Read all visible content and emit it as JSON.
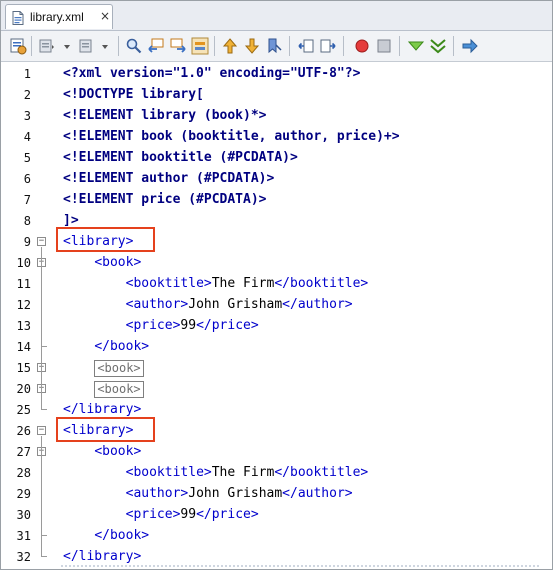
{
  "tab": {
    "title": "library.xml",
    "close": "×"
  },
  "toolbar": {
    "icons": [
      "source-history-icon",
      "back-icon",
      "forward-icon",
      "find-icon",
      "find-previous-icon",
      "find-next-icon",
      "toggle-highlight-icon",
      "previous-bookmark-icon",
      "next-bookmark-icon",
      "toggle-bookmark-icon",
      "shift-left-icon",
      "shift-right-icon",
      "start-macro-icon",
      "stop-macro-icon",
      "check-xml-icon",
      "validate-xml-icon",
      "xsl-transform-icon"
    ]
  },
  "editor": {
    "lines": [
      {
        "num": "1",
        "fold": "",
        "parts": [
          {
            "c": "dtd",
            "t": "<?xml version=\"1.0\" encoding=\"UTF-8\"?>"
          }
        ]
      },
      {
        "num": "2",
        "fold": "",
        "parts": [
          {
            "c": "dtd",
            "t": "<!DOCTYPE library["
          }
        ]
      },
      {
        "num": "3",
        "fold": "",
        "parts": [
          {
            "c": "dtd",
            "t": "<!ELEMENT library (book)*>"
          }
        ]
      },
      {
        "num": "4",
        "fold": "",
        "parts": [
          {
            "c": "dtd",
            "t": "<!ELEMENT book (booktitle, author, price)+>"
          }
        ]
      },
      {
        "num": "5",
        "fold": "",
        "parts": [
          {
            "c": "dtd",
            "t": "<!ELEMENT booktitle (#PCDATA)>"
          }
        ]
      },
      {
        "num": "6",
        "fold": "",
        "parts": [
          {
            "c": "dtd",
            "t": "<!ELEMENT author (#PCDATA)>"
          }
        ]
      },
      {
        "num": "7",
        "fold": "",
        "parts": [
          {
            "c": "dtd",
            "t": "<!ELEMENT price (#PCDATA)>"
          }
        ]
      },
      {
        "num": "8",
        "fold": "",
        "parts": [
          {
            "c": "dtd",
            "t": "]>"
          }
        ]
      },
      {
        "num": "9",
        "fold": "−",
        "parts": [
          {
            "c": "tagc",
            "t": "<library>"
          }
        ]
      },
      {
        "num": "10",
        "fold": "−",
        "parts": [
          {
            "c": "txt",
            "t": "    "
          },
          {
            "c": "tagc",
            "t": "<book>"
          }
        ]
      },
      {
        "num": "11",
        "fold": "",
        "parts": [
          {
            "c": "txt",
            "t": "        "
          },
          {
            "c": "tagc",
            "t": "<booktitle>"
          },
          {
            "c": "txt",
            "t": "The Firm"
          },
          {
            "c": "tagc",
            "t": "</booktitle>"
          }
        ]
      },
      {
        "num": "12",
        "fold": "",
        "parts": [
          {
            "c": "txt",
            "t": "        "
          },
          {
            "c": "tagc",
            "t": "<author>"
          },
          {
            "c": "txt",
            "t": "John Grisham"
          },
          {
            "c": "tagc",
            "t": "</author>"
          }
        ]
      },
      {
        "num": "13",
        "fold": "",
        "parts": [
          {
            "c": "txt",
            "t": "        "
          },
          {
            "c": "tagc",
            "t": "<price>"
          },
          {
            "c": "txt",
            "t": "99"
          },
          {
            "c": "tagc",
            "t": "</price>"
          }
        ]
      },
      {
        "num": "14",
        "fold": "end",
        "parts": [
          {
            "c": "txt",
            "t": "    "
          },
          {
            "c": "tagc",
            "t": "</book>"
          }
        ]
      },
      {
        "num": "15",
        "fold": "+",
        "parts": [
          {
            "c": "txt",
            "t": "    "
          },
          {
            "c": "folded",
            "t": "<book>"
          }
        ]
      },
      {
        "num": "20",
        "fold": "+",
        "parts": [
          {
            "c": "txt",
            "t": "    "
          },
          {
            "c": "folded",
            "t": "<book>"
          }
        ]
      },
      {
        "num": "25",
        "fold": "end",
        "parts": [
          {
            "c": "tagc",
            "t": "</library>"
          }
        ]
      },
      {
        "num": "26",
        "fold": "−",
        "parts": [
          {
            "c": "tagc",
            "t": "<library>"
          }
        ]
      },
      {
        "num": "27",
        "fold": "−",
        "parts": [
          {
            "c": "txt",
            "t": "    "
          },
          {
            "c": "tagc",
            "t": "<book>"
          }
        ]
      },
      {
        "num": "28",
        "fold": "",
        "parts": [
          {
            "c": "txt",
            "t": "        "
          },
          {
            "c": "tagc",
            "t": "<booktitle>"
          },
          {
            "c": "txt",
            "t": "The Firm"
          },
          {
            "c": "tagc",
            "t": "</booktitle>"
          }
        ]
      },
      {
        "num": "29",
        "fold": "",
        "parts": [
          {
            "c": "txt",
            "t": "        "
          },
          {
            "c": "tagc",
            "t": "<author>"
          },
          {
            "c": "txt",
            "t": "John Grisham"
          },
          {
            "c": "tagc",
            "t": "</author>"
          }
        ]
      },
      {
        "num": "30",
        "fold": "",
        "parts": [
          {
            "c": "txt",
            "t": "        "
          },
          {
            "c": "tagc",
            "t": "<price>"
          },
          {
            "c": "txt",
            "t": "99"
          },
          {
            "c": "tagc",
            "t": "</price>"
          }
        ]
      },
      {
        "num": "31",
        "fold": "end",
        "parts": [
          {
            "c": "txt",
            "t": "    "
          },
          {
            "c": "tagc",
            "t": "</book>"
          }
        ]
      },
      {
        "num": "32",
        "fold": "end",
        "parts": [
          {
            "c": "tagc",
            "t": "</library>"
          }
        ]
      }
    ]
  },
  "colors": {
    "tag": "#0000cc",
    "dtd": "#000080",
    "highlight": "#e5411d"
  }
}
